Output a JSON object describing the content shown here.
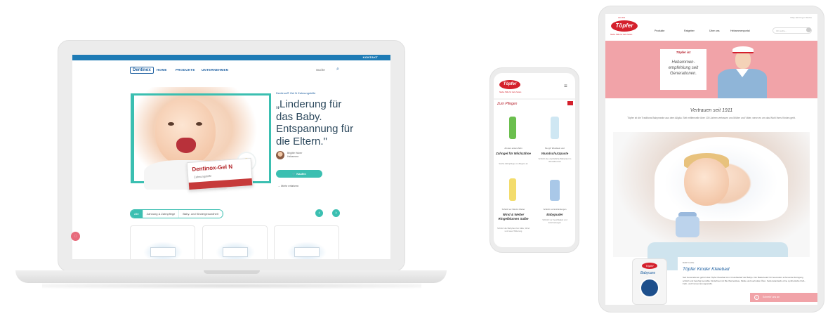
{
  "laptop": {
    "kontakt": "KONTAKT",
    "logo": "Dentinox",
    "nav": [
      "HOME",
      "PRODUKTE",
      "UNTERNEHMEN"
    ],
    "search_label": "Suche",
    "kicker": "Dentinox® Gel N Zahnungshilfe",
    "headline": "„Linderung für das Baby. Entspannung für die Eltern.\"",
    "author_name": "Brigitte Huber",
    "author_role": "Hebamme",
    "buy_label": "Kaufen",
    "more_label": "Mehr erfahren",
    "product_label": "Dentinox-Gel N",
    "product_sub": "Zahnungshilfe",
    "tabs": [
      "Alle",
      "Zahnung & Zahnpflege",
      "Baby- und Kindergesundheit"
    ],
    "prev_icon": "arrow-left-icon",
    "next_icon": "arrow-right-icon"
  },
  "phone": {
    "logo": "Töpfer",
    "logo_sub": "Starke Hülle für zarte Seiten",
    "menu_icon": "hamburger-menu-icon",
    "section_title": "Zum Pflegen",
    "products": [
      {
        "caption": "Ab dem ersten Zahn",
        "name": "Zahngel für Milchzähne",
        "desc": "Sanfte Zahnpflege von Beginn an"
      },
      {
        "caption": "Bei gif. Wundsein und",
        "name": "Wundschutzpaste",
        "desc": "Schützt die empfindliche Babyhaut im Windelbereich"
      },
      {
        "caption": "Schützt vor Wind & Wetter",
        "name": "Wind & Wetter Ringelblumen Salbe",
        "desc": "Schützt die Babyhaut bei Kälte, Wind und rauer Witterung"
      },
      {
        "caption": "Schützt vor Entzündungen",
        "name": "Babypuder",
        "desc": "Schützt vor Feuchtigkeit und Entzündungen"
      }
    ],
    "chat_icon": "chat-icon"
  },
  "tablet": {
    "toplinks": "FAQ   Jetzt log in   Suche",
    "logo_top": "seit 1911",
    "logo": "Töpfer",
    "logo_sub": "Starke Hülle für zarte Seiten",
    "nav": [
      "Produkte",
      "Ratgeber",
      "Über uns",
      "Hebammenportal"
    ],
    "search_placeholder": "Ich suche...",
    "hero_title": "Töpfer ist",
    "hero_text": "Hebammen-empfehlung seit Generationen.",
    "section_title": "Vertrauen seit 1911",
    "section_text": "Töpfer ist die Traditions Babymarke aus dem Allgäu. Seit mittlerweile über 100 Jahren vertrauen uns Mütter und Väter, wenn es um das Wohl Ihres Kindes geht.",
    "info_kicker": "BABYCARE",
    "info_title": "Töpfer Kinder Kleiebad",
    "info_text": "Seit Generationen gehört das Töpfer Kleiebad zum Grundbedarf der Babys. Der Badezusatz für besonders schonende Reinigung schützt und beruhigt sensible Kinderhaut mit Bio-Weizenkleie, Molke und wertvollen Ölen. Seifenstandards ohne synthetische Duft-, Farb- und Konservierungsstoffe.",
    "product_label": "Töpfer",
    "product_name": "Babycare",
    "cta_label": "Schreib' uns an",
    "cta_icon": "chat-icon"
  }
}
